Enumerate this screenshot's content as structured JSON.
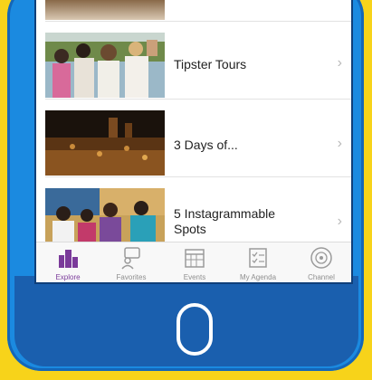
{
  "list": {
    "items": [
      {
        "title": "Tipster Tours",
        "chevron": "›"
      },
      {
        "title": "3 Days of...",
        "chevron": "›"
      },
      {
        "title": "5 Instagrammable Spots",
        "chevron": "›"
      }
    ]
  },
  "tabbar": {
    "tabs": [
      {
        "label": "Explore",
        "icon": "buildings-icon",
        "active": true
      },
      {
        "label": "Favorites",
        "icon": "chat-user-icon",
        "active": false
      },
      {
        "label": "Events",
        "icon": "calendar-icon",
        "active": false
      },
      {
        "label": "My Agenda",
        "icon": "checklist-icon",
        "active": false
      },
      {
        "label": "Channel",
        "icon": "broadcast-icon",
        "active": false
      }
    ]
  },
  "colors": {
    "background": "#f7d31a",
    "phone": "#1b8ae0",
    "accent": "#7a3a9a"
  }
}
